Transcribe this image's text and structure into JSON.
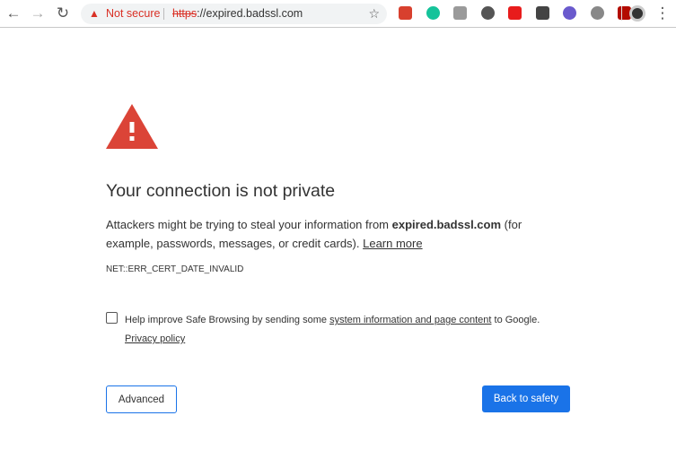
{
  "browser": {
    "security_label": "Not secure",
    "url_scheme": "https",
    "url_rest": "://expired.badssl.com",
    "back_icon": "←",
    "forward_icon": "→",
    "reload_icon": "↻",
    "star_icon": "☆",
    "menu_icon": "⋮",
    "extensions": [
      {
        "name": "bookmark-extension-icon",
        "color": "#d8402e"
      },
      {
        "name": "grammarly-extension-icon",
        "color": "#15c39a"
      },
      {
        "name": "notes-extension-icon",
        "color": "#9a9a9a"
      },
      {
        "name": "circle-extension-icon",
        "color": "#555555"
      },
      {
        "name": "adblock-extension-icon",
        "color": "#e81c1c"
      },
      {
        "name": "m-extension-icon",
        "color": "#444444"
      },
      {
        "name": "eye-extension-icon",
        "color": "#6a5acd"
      },
      {
        "name": "gear-extension-icon",
        "color": "#888888"
      },
      {
        "name": "pdf-extension-icon",
        "color": "#b30b00"
      }
    ]
  },
  "interstitial": {
    "title": "Your connection is not private",
    "message_before": "Attackers might be trying to steal your information from ",
    "domain": "expired.badssl.com",
    "message_after": " (for example, passwords, messages, or credit cards). ",
    "learn_more": "Learn more",
    "error_code": "NET::ERR_CERT_DATE_INVALID",
    "checkbox_before": "Help improve Safe Browsing by sending some ",
    "checkbox_link": "system information and page content",
    "checkbox_after": " to Google.",
    "privacy_policy": "Privacy policy",
    "advanced_label": "Advanced",
    "back_label": "Back to safety",
    "checkbox_checked": false
  },
  "colors": {
    "accent": "#1a73e8",
    "danger": "#d93025",
    "warning_triangle": "#db4437"
  }
}
